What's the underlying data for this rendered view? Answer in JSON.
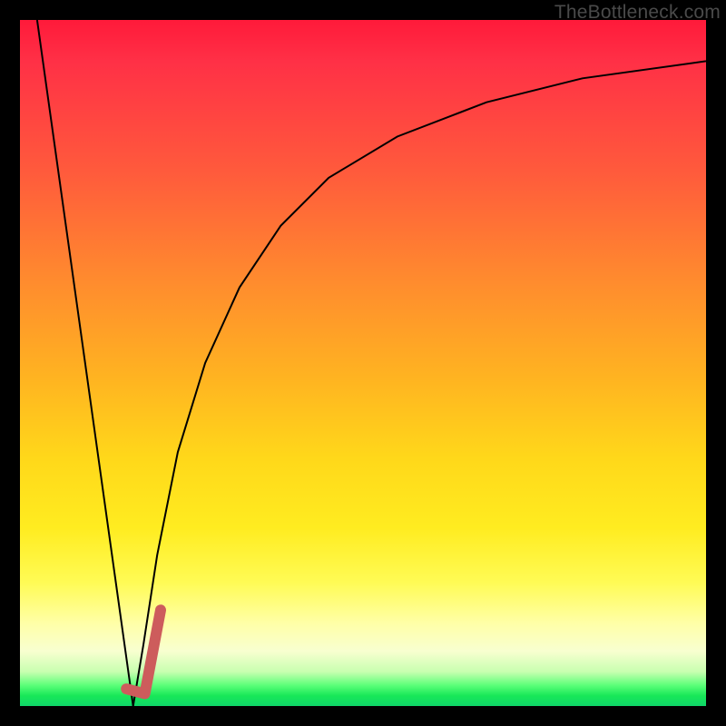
{
  "watermark": {
    "text": "TheBottleneck.com"
  },
  "gradient_colors": {
    "top": "#ff1a3a",
    "mid_orange": "#ff8b2e",
    "mid_yellow": "#ffec20",
    "pale": "#ffffa8",
    "green": "#18e858"
  },
  "chart_data": {
    "type": "line",
    "title": "",
    "xlabel": "",
    "ylabel": "",
    "xlim": [
      0,
      100
    ],
    "ylim": [
      0,
      100
    ],
    "grid": false,
    "legend": false,
    "series": [
      {
        "name": "left-slope",
        "stroke": "#000000",
        "stroke_width": 2,
        "x": [
          2.5,
          16.5
        ],
        "y": [
          100,
          0
        ]
      },
      {
        "name": "asymptotic-curve",
        "stroke": "#000000",
        "stroke_width": 2,
        "x": [
          16.5,
          18,
          20,
          23,
          27,
          32,
          38,
          45,
          55,
          68,
          82,
          100
        ],
        "y": [
          0,
          9,
          22,
          37,
          50,
          61,
          70,
          77,
          83,
          88,
          91.5,
          94
        ]
      },
      {
        "name": "pink-marker",
        "stroke": "#cd5c5c",
        "stroke_width": 12,
        "linecap": "round",
        "x": [
          15.5,
          18.2,
          20.5
        ],
        "y": [
          2.5,
          1.8,
          14
        ]
      }
    ],
    "annotations": []
  }
}
